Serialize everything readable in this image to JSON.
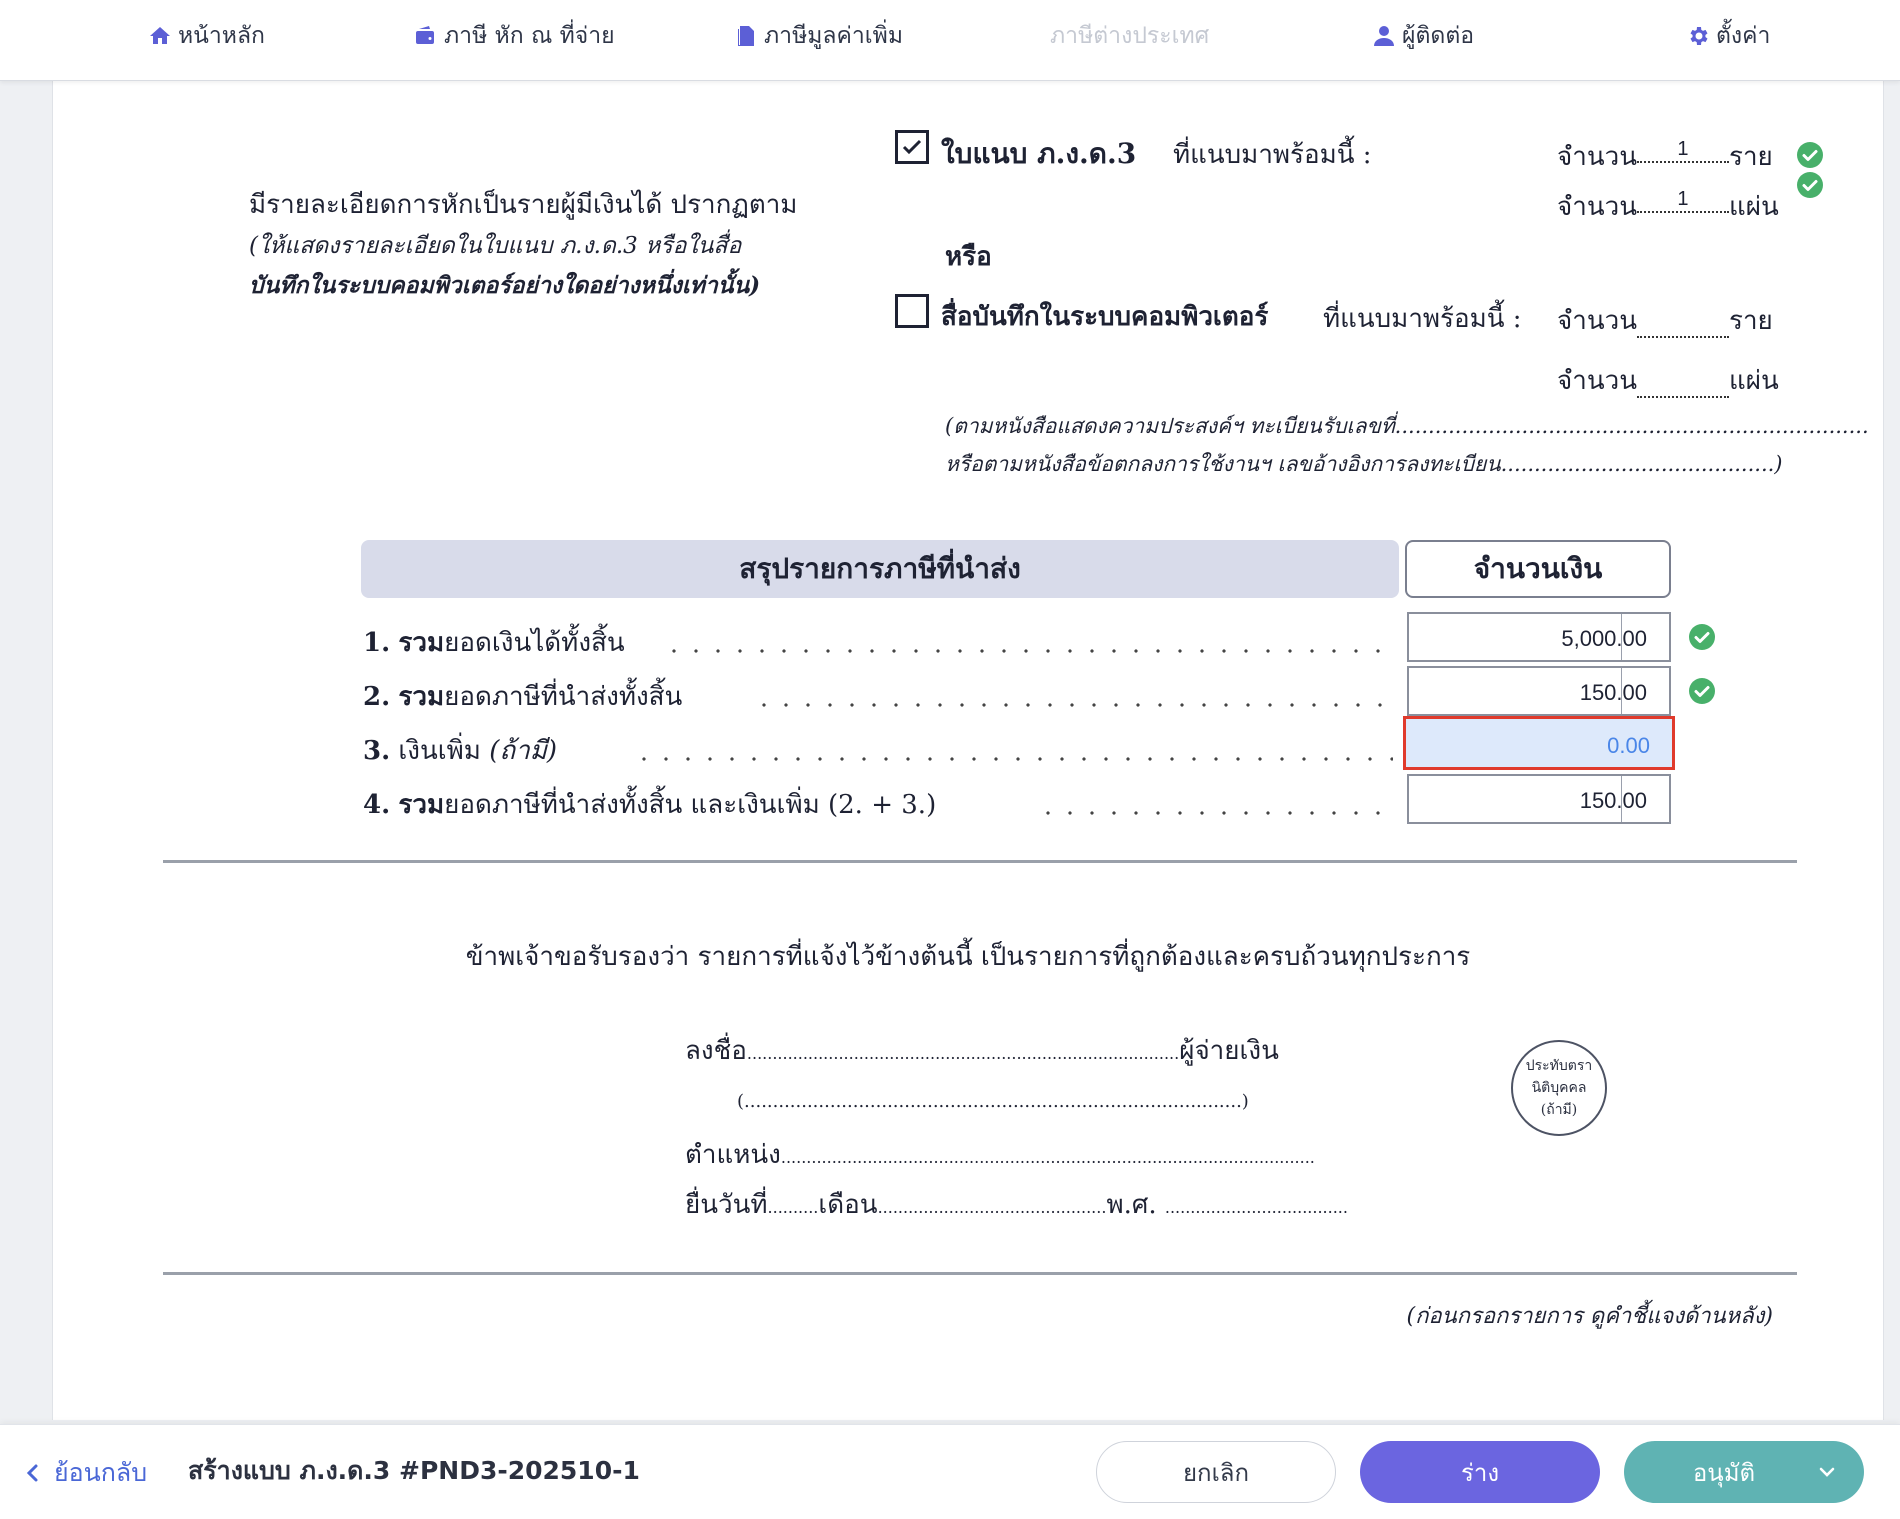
{
  "nav": {
    "items": [
      {
        "label": "หน้าหลัก",
        "icon": "home-icon"
      },
      {
        "label": "ภาษี หัก ณ ที่จ่าย",
        "icon": "wallet-icon"
      },
      {
        "label": "ภาษีมูลค่าเพิ่ม",
        "icon": "document-icon"
      },
      {
        "label": "ภาษีต่างประเทศ",
        "disabled": true
      },
      {
        "label": "ผู้ติดต่อ",
        "icon": "user-icon"
      },
      {
        "label": "ตั้งค่า",
        "icon": "gear-icon"
      }
    ]
  },
  "form": {
    "detail_text": "มีรายละเอียดการหักเป็นรายผู้มีเงินได้ ปรากฏตาม",
    "detail_note_1": "(ให้แสดงรายละเอียดในใบแนบ ภ.ง.ด.3 หรือในสื่อ",
    "detail_note_2": "บันทึกในระบบคอมพิวเตอร์อย่างใดอย่างหนึ่งเท่านั้น)",
    "attach_label": "ใบแนบ ภ.ง.ด.3",
    "attach_suffix": "ที่แนบมาพร้อมนี้ :",
    "attach_checked": true,
    "attach_count_label": "จำนวน",
    "attach_persons_value": "1",
    "attach_persons_unit": "ราย",
    "attach_sheets_value": "1",
    "attach_sheets_unit": "แผ่น",
    "or_label": "หรือ",
    "media_label": "สื่อบันทึกในระบบคอมพิวเตอร์",
    "media_suffix": "ที่แนบมาพร้อมนี้ :",
    "media_checked": false,
    "media_count_label": "จำนวน",
    "media_persons_unit": "ราย",
    "media_sheets_unit": "แผ่น",
    "ref_note_1": "(ตามหนังสือแสดงความประสงค์ฯ ทะเบียนรับเลขที่.......................................................................",
    "ref_note_2": "หรือตามหนังสือข้อตกลงการใช้งานฯ เลขอ้างอิงการลงทะเบียน.........................................)"
  },
  "summary": {
    "title": "สรุปรายการภาษีที่นำส่ง",
    "amount_header": "จำนวนเงิน",
    "rows": [
      {
        "num": "1.",
        "bold": "รวม",
        "label": "ยอดเงินได้ทั้งสิ้น",
        "value": "5,000.00",
        "verified": true
      },
      {
        "num": "2.",
        "bold": "รวม",
        "label": "ยอดภาษีที่นำส่งทั้งสิ้น",
        "value": "150.00",
        "verified": true
      },
      {
        "num": "3.",
        "bold": "",
        "label": "เงินเพิ่ม",
        "label_italic": "(ถ้ามี)",
        "value": "0.00",
        "editing": true
      },
      {
        "num": "4.",
        "bold": "รวม",
        "label": "ยอดภาษีที่นำส่งทั้งสิ้น และเงินเพิ่ม (2. + 3.)",
        "value": "150.00"
      }
    ]
  },
  "certify": {
    "statement": "ข้าพเจ้าขอรับรองว่า รายการที่แจ้งไว้ข้างต้นนี้ เป็นรายการที่ถูกต้องและครบถ้วนทุกประการ",
    "sign_label": "ลงชื่อ",
    "sign_dots": ".....................................................................................",
    "payer_label": "ผู้จ่ายเงิน",
    "name_line": "(.......................................................................................)",
    "position_label": "ตำแหน่ง",
    "position_dots": ".........................................................................................................",
    "date_label": "ยื่นวันที่",
    "date_dots": "..........",
    "month_label": "เดือน",
    "month_dots": ".............................................",
    "year_label": "พ.ศ.",
    "year_dots": "....................................",
    "seal_lines": [
      "ประทับตรา",
      "นิติบุคคล",
      "(ถ้ามี)"
    ],
    "footer_note": "(ก่อนกรอกรายการ ดูคำชี้แจงด้านหลัง)"
  },
  "bottom": {
    "back_label": "ย้อนกลับ",
    "doc_title": "สร้างแบบ ภ.ง.ด.3 #PND3-202510-1",
    "cancel_label": "ยกเลิก",
    "draft_label": "ร่าง",
    "approve_label": "อนุมัติ"
  },
  "colors": {
    "accent": "#6b65e0",
    "approve": "#5fb3b3",
    "verified": "#48b06a",
    "error_border": "#e03a2c"
  }
}
